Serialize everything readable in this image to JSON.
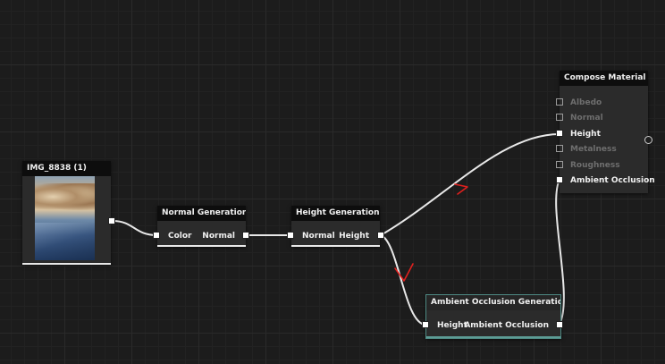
{
  "nodes": {
    "image": {
      "title": "IMG_8838 (1)",
      "thumbnail_icon": "photo-thumbnail"
    },
    "normal_gen": {
      "title": "Normal Generation",
      "input": "Color",
      "output": "Normal"
    },
    "height_gen": {
      "title": "Height Generation",
      "input": "Normal",
      "output": "Height"
    },
    "ao_gen": {
      "title": "Ambient Occlusion Generation",
      "input": "Height",
      "output": "Ambient Occlusion"
    },
    "compose": {
      "title": "Compose Material",
      "inputs": [
        {
          "label": "Albedo",
          "connected": false
        },
        {
          "label": "Normal",
          "connected": false
        },
        {
          "label": "Height",
          "connected": true
        },
        {
          "label": "Metalness",
          "connected": false
        },
        {
          "label": "Roughness",
          "connected": false
        },
        {
          "label": "Ambient Occlusion",
          "connected": true
        }
      ]
    }
  },
  "colors": {
    "background": "#1c1c1c",
    "node_body": "#2b2b2b",
    "node_title": "#0d0d0d",
    "wire": "#e8e8e8",
    "annotation": "#e0201e",
    "ao_border": "#4f8a84"
  }
}
